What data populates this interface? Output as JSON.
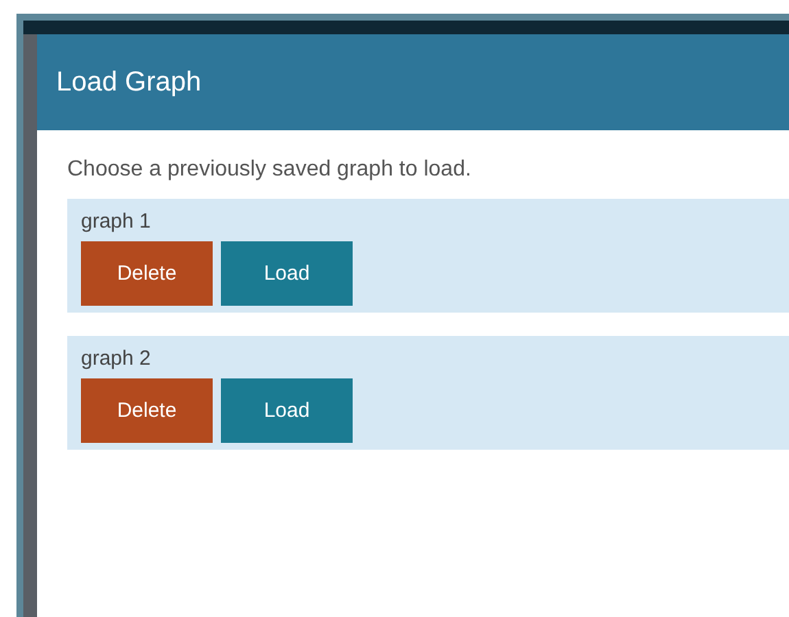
{
  "dialog": {
    "title": "Load Graph",
    "message": "Choose a previously saved graph to load.",
    "graphs": [
      {
        "name": "graph 1",
        "buttons": [
          {
            "kind": "delete",
            "label": "Delete"
          },
          {
            "kind": "load",
            "label": "Load"
          }
        ]
      },
      {
        "name": "graph 2",
        "buttons": [
          {
            "kind": "delete",
            "label": "Delete"
          },
          {
            "kind": "load",
            "label": "Load"
          }
        ]
      }
    ]
  }
}
